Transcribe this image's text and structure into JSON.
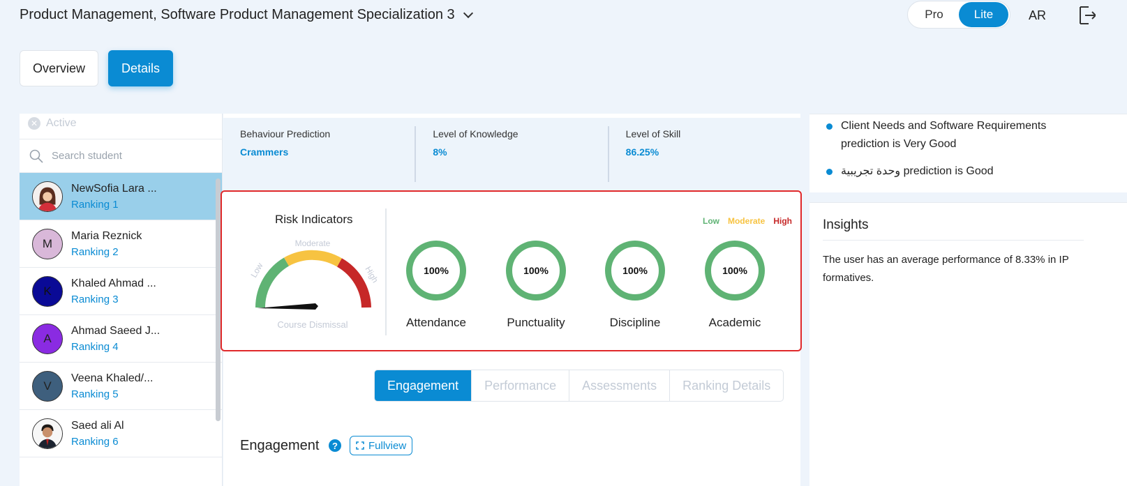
{
  "header": {
    "course_title": "Product Management, Software Product Management Specialization 3",
    "mode_pro": "Pro",
    "mode_lite": "Lite",
    "language": "AR"
  },
  "view_tabs": {
    "overview": "Overview",
    "details": "Details"
  },
  "left_panel": {
    "active_filter": "Active",
    "search_placeholder": "Search student",
    "students": [
      {
        "name": "NewSofia Lara ...",
        "ranking": "Ranking 1",
        "initial": "",
        "avatar_color": "#ffffff",
        "selected": true
      },
      {
        "name": "Maria Reznick",
        "ranking": "Ranking 2",
        "initial": "M",
        "avatar_color": "#d9b8d9"
      },
      {
        "name": "Khaled Ahmad ...",
        "ranking": "Ranking 3",
        "initial": "K",
        "avatar_color": "#0a0a96"
      },
      {
        "name": "Ahmad Saeed J...",
        "ranking": "Ranking 4",
        "initial": "A",
        "avatar_color": "#8a2be2"
      },
      {
        "name": "Veena Khaled/...",
        "ranking": "Ranking 5",
        "initial": "V",
        "avatar_color": "#3e5f7d"
      },
      {
        "name": "Saed ali Al",
        "ranking": "Ranking 6",
        "initial": "",
        "avatar_color": "#ffffff"
      }
    ]
  },
  "predictions": [
    {
      "label": "Behaviour Prediction",
      "value": "Crammers"
    },
    {
      "label": "Level of Knowledge",
      "value": "8%"
    },
    {
      "label": "Level of Skill",
      "value": "86.25%"
    }
  ],
  "risk": {
    "title": "Risk Indicators",
    "gauge_moderate": "Moderate",
    "gauge_low": "Low",
    "gauge_high": "High",
    "gauge_bottom": "Course Dismissal",
    "legend": {
      "low": "Low",
      "moderate": "Moderate",
      "high": "High"
    },
    "colors": {
      "low": "#5fb374",
      "moderate": "#f7c341",
      "high": "#c62828"
    },
    "indicators": [
      {
        "label": "Attendance",
        "value": "100%"
      },
      {
        "label": "Punctuality",
        "value": "100%"
      },
      {
        "label": "Discipline",
        "value": "100%"
      },
      {
        "label": "Academic",
        "value": "100%"
      }
    ]
  },
  "sub_tabs": [
    "Engagement",
    "Performance",
    "Assessments",
    "Ranking Details"
  ],
  "engagement": {
    "title": "Engagement",
    "help": "?",
    "fullview": "Fullview"
  },
  "right_panel": {
    "predictions": [
      "Client Needs and Software Requirements prediction is Very Good",
      "وحدة تجريبية prediction is Good"
    ],
    "insights_title": "Insights",
    "insights_text": "The user has an average performance of 8.33% in IP formatives."
  },
  "accent_color": "#0a8bd3"
}
